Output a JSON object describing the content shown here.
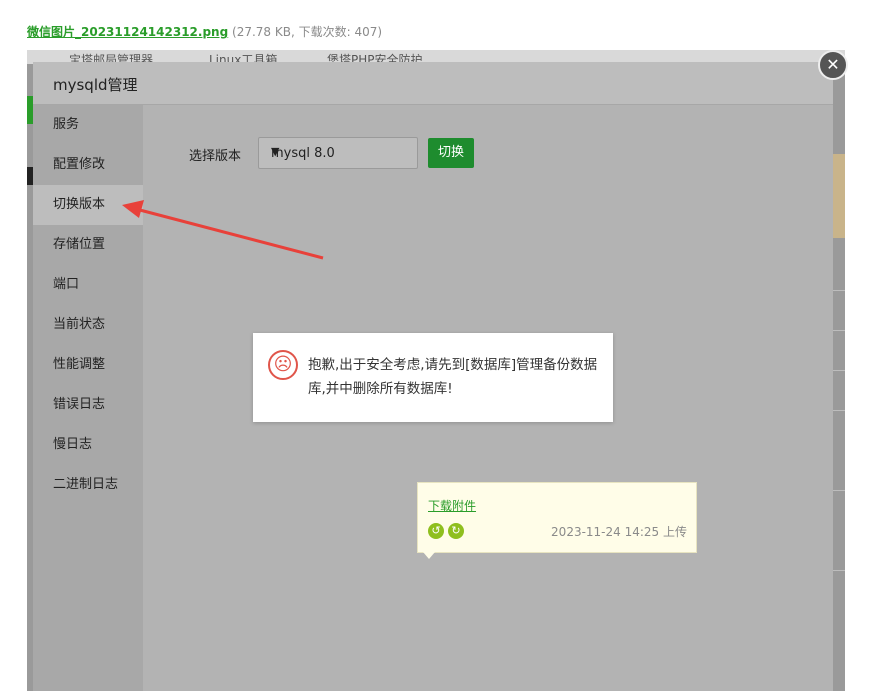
{
  "attachment": {
    "filename": "微信图片_20231124142312.png",
    "meta": "(27.78 KB, 下载次数: 407)"
  },
  "background_tabs": [
    "宝塔邮局管理器",
    "Linux工具箱",
    "堡塔PHP安全防护"
  ],
  "modal": {
    "title": "mysqld管理",
    "sidebar": [
      {
        "label": "服务",
        "active": false
      },
      {
        "label": "配置修改",
        "active": false
      },
      {
        "label": "切换版本",
        "active": true
      },
      {
        "label": "存储位置",
        "active": false
      },
      {
        "label": "端口",
        "active": false
      },
      {
        "label": "当前状态",
        "active": false
      },
      {
        "label": "性能调整",
        "active": false
      },
      {
        "label": "错误日志",
        "active": false
      },
      {
        "label": "慢日志",
        "active": false
      },
      {
        "label": "二进制日志",
        "active": false
      }
    ],
    "version_label": "选择版本",
    "version_value": "mysql 8.0",
    "switch_label": "切换"
  },
  "alert": {
    "icon": "sad-face-icon",
    "message": "抱歉,出于安全考虑,请先到[数据库]管理备份数据库,并中删除所有数据库!"
  },
  "tooltip": {
    "download_label": "下载附件",
    "timestamp": "2023-11-24 14:25 上传"
  },
  "colors": {
    "accent": "#1e8c2e",
    "link": "#2a9d2a",
    "alert_icon": "#e0554a",
    "arrow": "#e8413a"
  }
}
